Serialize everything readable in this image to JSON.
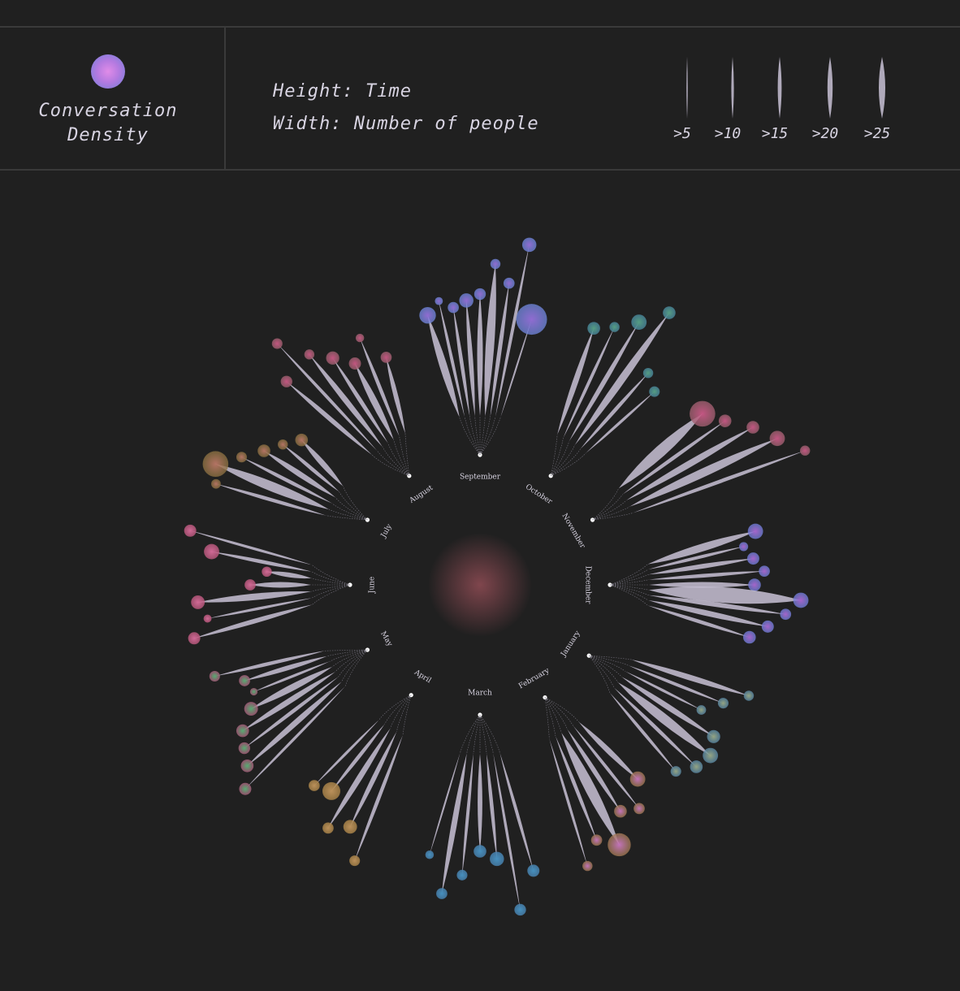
{
  "legend": {
    "density_label": "Conversation\nDensity",
    "height_label": "Height: Time",
    "width_label": "Width: Number of people",
    "width_scale": [
      ">5",
      ">10",
      ">15",
      ">20",
      ">25"
    ],
    "width_scale_values": [
      5,
      10,
      15,
      20,
      25
    ]
  },
  "colors": {
    "background": "#202020",
    "stem": "#c9c2d6",
    "text": "#d8d4e2"
  },
  "chart_data": {
    "type": "radial branching timeline",
    "center_glow_color": "#8a4a52",
    "months": [
      {
        "name": "September",
        "angle": 0,
        "dot_color": "#9a72e0",
        "halo_color": "#6d85d8",
        "branches": [
          [
            0.52,
            0.14,
            0.45
          ],
          [
            0.58,
            0.05,
            0.12
          ],
          [
            0.54,
            0.06,
            0.24
          ],
          [
            0.57,
            0.08,
            0.36
          ],
          [
            0.6,
            0.1,
            0.26
          ],
          [
            0.75,
            0.16,
            0.2
          ],
          [
            0.66,
            0.07,
            0.24
          ],
          [
            0.86,
            0.05,
            0.36
          ],
          [
            0.5,
            0.02,
            1.0
          ]
        ]
      },
      {
        "name": "October",
        "angle": 33,
        "dot_color": "#5aa88a",
        "halo_color": "#4a8aa0",
        "branches": [
          [
            0.55,
            0.1,
            0.3
          ],
          [
            0.6,
            0.05,
            0.2
          ],
          [
            0.68,
            0.08,
            0.4
          ],
          [
            0.8,
            0.14,
            0.3
          ],
          [
            0.5,
            0.06,
            0.2
          ],
          [
            0.45,
            0.04,
            0.22
          ]
        ]
      },
      {
        "name": "November",
        "angle": 60,
        "dot_color": "#d05a8a",
        "halo_color": "#a06070",
        "branches": [
          [
            0.55,
            0.22,
            0.8
          ],
          [
            0.62,
            0.06,
            0.3
          ],
          [
            0.72,
            0.12,
            0.3
          ],
          [
            0.8,
            0.16,
            0.4
          ],
          [
            0.9,
            0.06,
            0.2
          ]
        ]
      },
      {
        "name": "December",
        "angle": 90,
        "dot_color": "#b06ad8",
        "halo_color": "#6f7ed8",
        "branches": [
          [
            0.55,
            0.14,
            0.4
          ],
          [
            0.48,
            0.05,
            0.16
          ],
          [
            0.52,
            0.08,
            0.28
          ],
          [
            0.57,
            0.06,
            0.24
          ],
          [
            0.52,
            0.1,
            0.3
          ],
          [
            0.75,
            0.3,
            0.4
          ],
          [
            0.68,
            0.08,
            0.24
          ],
          [
            0.6,
            0.1,
            0.28
          ],
          [
            0.52,
            0.06,
            0.3
          ]
        ]
      },
      {
        "name": "January",
        "angle": 123,
        "dot_color": "#9fb08a",
        "halo_color": "#5a8aa8",
        "branches": [
          [
            0.6,
            0.1,
            0.2
          ],
          [
            0.5,
            0.05,
            0.22
          ],
          [
            0.42,
            0.04,
            0.18
          ],
          [
            0.54,
            0.1,
            0.32
          ],
          [
            0.58,
            0.18,
            0.4
          ],
          [
            0.56,
            0.06,
            0.3
          ],
          [
            0.5,
            0.05,
            0.22
          ]
        ]
      },
      {
        "name": "February",
        "angle": 150,
        "dot_color": "#d07ac8",
        "halo_color": "#a07850",
        "branches": [
          [
            0.4,
            0.1,
            0.4
          ],
          [
            0.52,
            0.05,
            0.24
          ],
          [
            0.48,
            0.08,
            0.3
          ],
          [
            0.62,
            0.2,
            0.7
          ],
          [
            0.55,
            0.06,
            0.24
          ],
          [
            0.65,
            0.04,
            0.2
          ]
        ]
      },
      {
        "name": "March",
        "angle": 180,
        "dot_color": "#4a9acc",
        "halo_color": "#4a88b8",
        "branches": [
          [
            0.6,
            0.05,
            0.28
          ],
          [
            0.78,
            0.04,
            0.26
          ],
          [
            0.52,
            0.06,
            0.36
          ],
          [
            0.48,
            0.08,
            0.3
          ],
          [
            0.6,
            0.05,
            0.22
          ],
          [
            0.7,
            0.1,
            0.24
          ],
          [
            0.52,
            0.02,
            0.14
          ]
        ]
      },
      {
        "name": "April",
        "angle": 212,
        "dot_color": "#c89a60",
        "halo_color": "#b0884a",
        "branches": [
          [
            0.66,
            0.06,
            0.22
          ],
          [
            0.52,
            0.08,
            0.34
          ],
          [
            0.58,
            0.1,
            0.24
          ],
          [
            0.42,
            0.06,
            0.5
          ],
          [
            0.45,
            0.04,
            0.24
          ]
        ]
      },
      {
        "name": "May",
        "angle": 240,
        "dot_color": "#5ab878",
        "halo_color": "#b06080",
        "branches": [
          [
            0.7,
            0.04,
            0.28
          ],
          [
            0.62,
            0.1,
            0.3
          ],
          [
            0.58,
            0.06,
            0.26
          ],
          [
            0.54,
            0.1,
            0.3
          ],
          [
            0.45,
            0.12,
            0.34
          ],
          [
            0.4,
            0.04,
            0.1
          ],
          [
            0.42,
            0.08,
            0.24
          ],
          [
            0.55,
            0.06,
            0.22
          ]
        ]
      },
      {
        "name": "June",
        "angle": 270,
        "dot_color": "#e070a0",
        "halo_color": "#c05a80",
        "branches": [
          [
            0.6,
            0.08,
            0.28
          ],
          [
            0.52,
            0.04,
            0.12
          ],
          [
            0.56,
            0.12,
            0.34
          ],
          [
            0.3,
            0.1,
            0.24
          ],
          [
            0.22,
            0.08,
            0.2
          ],
          [
            0.5,
            0.06,
            0.4
          ],
          [
            0.62,
            0.04,
            0.28
          ]
        ]
      },
      {
        "name": "July",
        "angle": 300,
        "dot_color": "#c07a6a",
        "halo_color": "#8a7040",
        "branches": [
          [
            0.56,
            0.06,
            0.18
          ],
          [
            0.6,
            0.18,
            0.8
          ],
          [
            0.5,
            0.06,
            0.22
          ],
          [
            0.42,
            0.1,
            0.3
          ],
          [
            0.36,
            0.06,
            0.2
          ],
          [
            0.3,
            0.1,
            0.3
          ]
        ]
      },
      {
        "name": "August",
        "angle": 327,
        "dot_color": "#d05a88",
        "halo_color": "#a06070",
        "branches": [
          [
            0.55,
            0.08,
            0.26
          ],
          [
            0.72,
            0.05,
            0.22
          ],
          [
            0.58,
            0.1,
            0.2
          ],
          [
            0.5,
            0.07,
            0.32
          ],
          [
            0.42,
            0.12,
            0.28
          ],
          [
            0.52,
            0.06,
            0.14
          ],
          [
            0.38,
            0.08,
            0.24
          ]
        ]
      }
    ]
  }
}
